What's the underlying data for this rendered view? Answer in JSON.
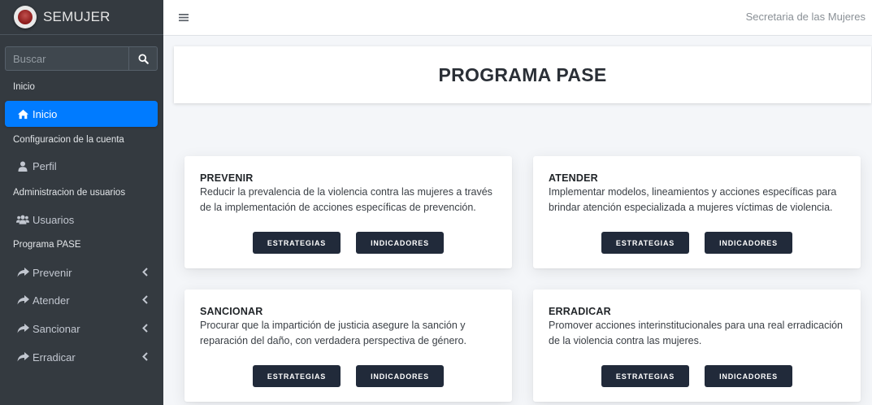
{
  "brand": {
    "name": "SEMUJER"
  },
  "search": {
    "placeholder": "Buscar"
  },
  "sidebar": {
    "sections": [
      {
        "header": "Inicio"
      },
      {
        "header": "Configuracion de la cuenta"
      },
      {
        "header": "Administracion de usuarios"
      },
      {
        "header": "Programa PASE"
      }
    ],
    "items": {
      "inicio": {
        "label": "Inicio",
        "icon": "home-icon"
      },
      "perfil": {
        "label": "Perfil",
        "icon": "user-icon"
      },
      "usuarios": {
        "label": "Usuarios",
        "icon": "users-icon"
      },
      "prevenir": {
        "label": "Prevenir",
        "icon": "share-icon"
      },
      "atender": {
        "label": "Atender",
        "icon": "share-icon"
      },
      "sancionar": {
        "label": "Sancionar",
        "icon": "share-icon"
      },
      "erradicar": {
        "label": "Erradicar",
        "icon": "share-icon"
      }
    }
  },
  "topbar": {
    "right_text": "Secretaria de las Mujeres"
  },
  "page": {
    "title": "PROGRAMA PASE"
  },
  "cards": [
    {
      "title": "PREVENIR",
      "description": "Reducir la prevalencia de la violencia contra las mujeres a través de la implementación de acciones específicas de prevención.",
      "btn1": "ESTRATEGIAS",
      "btn2": "INDICADORES"
    },
    {
      "title": "ATENDER",
      "description": "Implementar modelos, lineamientos y acciones específicas para brindar atención especializada a mujeres víctimas de violencia.",
      "btn1": "ESTRATEGIAS",
      "btn2": "INDICADORES"
    },
    {
      "title": "SANCIONAR",
      "description": "Procurar que la impartición de justicia asegure la sanción y reparación del daño, con verdadera perspectiva de género.",
      "btn1": "ESTRATEGIAS",
      "btn2": "INDICADORES"
    },
    {
      "title": "ERRADICAR",
      "description": "Promover acciones interinstitucionales para una real erradicación de la violencia contra las mujeres.",
      "btn1": "ESTRATEGIAS",
      "btn2": "INDICADORES"
    }
  ],
  "colors": {
    "sidebar": "#343a40",
    "active": "#007bff",
    "button": "#212a3a"
  }
}
